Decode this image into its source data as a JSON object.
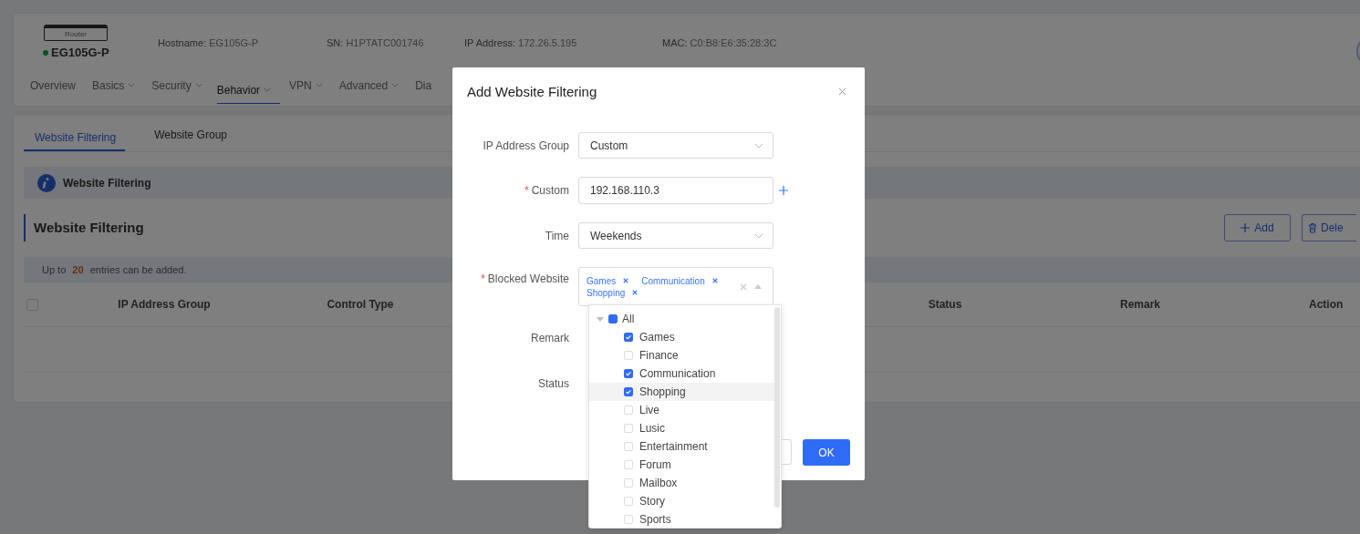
{
  "device": {
    "model_label": "Router",
    "name": "EG105G-P",
    "online": true,
    "info": [
      {
        "label": "Hostname:",
        "value": "EG105G-P"
      },
      {
        "label": "SN:",
        "value": "H1PTATC001746"
      },
      {
        "label": "IP Address:",
        "value": "172.26.5.195"
      },
      {
        "label": "MAC:",
        "value": "C0:B8:E6:35:28:3C"
      }
    ]
  },
  "nav": [
    {
      "label": "Overview",
      "dropdown": false,
      "selected": false
    },
    {
      "label": "Basics",
      "dropdown": true,
      "selected": false
    },
    {
      "label": "Security",
      "dropdown": true,
      "selected": false
    },
    {
      "label": "Behavior",
      "dropdown": true,
      "selected": true
    },
    {
      "label": "VPN",
      "dropdown": true,
      "selected": false
    },
    {
      "label": "Advanced",
      "dropdown": true,
      "selected": false
    },
    {
      "label": "Dia",
      "dropdown": false,
      "selected": false
    }
  ],
  "subtabs": [
    {
      "label": "Website Filtering",
      "selected": true
    },
    {
      "label": "Website Group",
      "selected": false
    }
  ],
  "info_banner": "Website Filtering",
  "section_title": "Website Filtering",
  "toolbar_buttons": [
    {
      "kind": "add",
      "label": "Add"
    },
    {
      "kind": "delete",
      "label": "Dele"
    }
  ],
  "limit_note": {
    "before": "Up to",
    "count": "20",
    "after": "entries can be added."
  },
  "table": {
    "select_all": false,
    "columns": [
      "IP Address Group",
      "Control Type",
      "Status",
      "Remark",
      "Action"
    ]
  },
  "dialog": {
    "title": "Add Website Filtering",
    "fields": [
      {
        "kind": "select",
        "label": "IP Address Group",
        "value": "Custom"
      },
      {
        "kind": "input",
        "label": "Custom",
        "required_mark": "*",
        "value": "192.168.110.3"
      },
      {
        "kind": "select",
        "label": "Time",
        "value": "Weekends"
      },
      {
        "kind": "tags",
        "label": "Blocked Website",
        "required_mark": "*",
        "tags": [
          "Games",
          "Communication",
          "Shopping"
        ]
      },
      {
        "kind": "covered",
        "label": "Remark"
      },
      {
        "kind": "covered",
        "label": "Status"
      }
    ],
    "ok": "OK"
  },
  "tree": {
    "label": "All",
    "expanded": true,
    "checked": false,
    "indeterminate": true,
    "children": [
      {
        "label": "Games",
        "checked": true,
        "highlighted": false
      },
      {
        "label": "Finance",
        "checked": false,
        "highlighted": false
      },
      {
        "label": "Communication",
        "checked": true,
        "highlighted": false
      },
      {
        "label": "Shopping",
        "checked": true,
        "highlighted": true
      },
      {
        "label": "Live",
        "checked": false,
        "highlighted": false
      },
      {
        "label": "Lusic",
        "checked": false,
        "highlighted": false
      },
      {
        "label": "Entertainment",
        "checked": false,
        "highlighted": false
      },
      {
        "label": "Forum",
        "checked": false,
        "highlighted": false
      },
      {
        "label": "Mailbox",
        "checked": false,
        "highlighted": false
      },
      {
        "label": "Story",
        "checked": false,
        "highlighted": false
      },
      {
        "label": "Sports",
        "checked": false,
        "highlighted": false
      }
    ]
  }
}
